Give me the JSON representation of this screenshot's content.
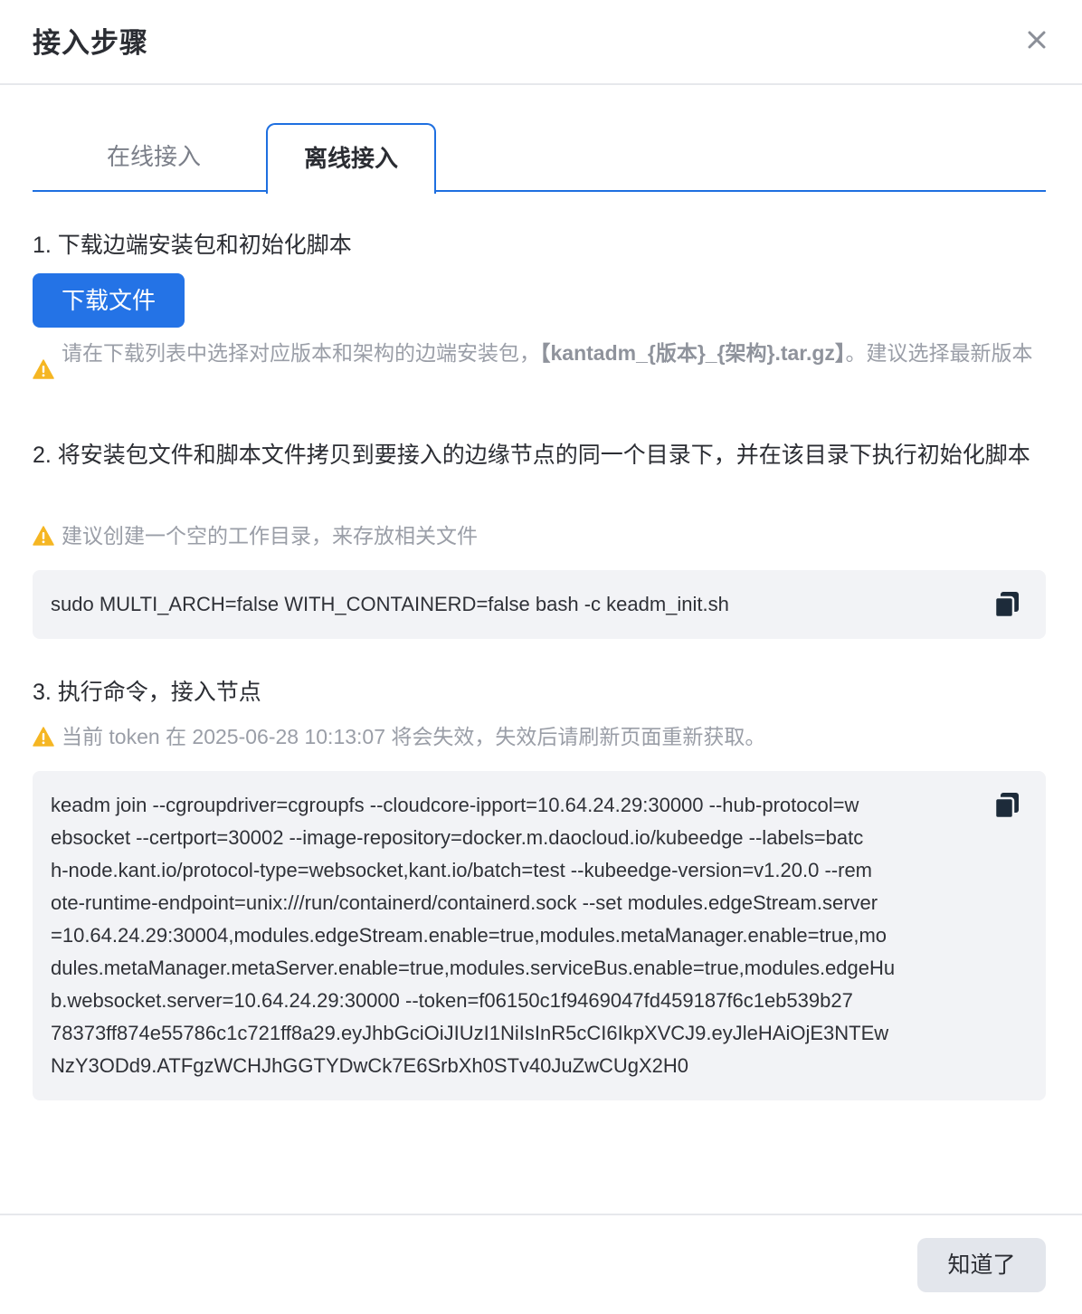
{
  "dialog": {
    "title": "接入步骤"
  },
  "tabs": [
    {
      "label": "在线接入",
      "active": false
    },
    {
      "label": "离线接入",
      "active": true
    }
  ],
  "step1": {
    "label": "1. 下载边端安装包和初始化脚本",
    "download_button": "下载文件",
    "warning_before": "请在下载列表中选择对应版本和架构的边端安装包，",
    "warning_bold": "【kantadm_{版本}_{架构}.tar.gz】",
    "warning_after": "。建议选择最新版本"
  },
  "step2": {
    "label": "2. 将安装包文件和脚本文件拷贝到要接入的边缘节点的同一个目录下，并在该目录下执行初始化脚本",
    "warning": "建议创建一个空的工作目录，来存放相关文件",
    "command": "sudo MULTI_ARCH=false WITH_CONTAINERD=false bash -c keadm_init.sh"
  },
  "step3": {
    "label": "3. 执行命令，接入节点",
    "warning": "当前 token 在 2025-06-28 10:13:07 将会失效，失效后请刷新页面重新获取。",
    "command_lines": [
      "keadm join --cgroupdriver=cgroupfs --cloudcore-ipport=10.64.24.29:30000 --hub-protocol=w",
      "ebsocket --certport=30002 --image-repository=docker.m.daocloud.io/kubeedge --labels=batc",
      "h-node.kant.io/protocol-type=websocket,kant.io/batch=test --kubeedge-version=v1.20.0 --rem",
      "ote-runtime-endpoint=unix:///run/containerd/containerd.sock  --set modules.edgeStream.server",
      "=10.64.24.29:30004,modules.edgeStream.enable=true,modules.metaManager.enable=true,mo",
      "dules.metaManager.metaServer.enable=true,modules.serviceBus.enable=true,modules.edgeHu",
      "b.websocket.server=10.64.24.29:30000 --token=f06150c1f9469047fd459187f6c1eb539b27",
      "78373ff874e55786c1c721ff8a29.eyJhbGciOiJIUzI1NiIsInR5cCI6IkpXVCJ9.eyJleHAiOjE3NTEw",
      "NzY3ODd9.ATFgzWCHJhGGTYDwCk7E6SrbXh0STv40JuZwCUgX2H0"
    ]
  },
  "footer": {
    "ok_button": "知道了"
  },
  "icons": {
    "close": "close-icon",
    "warning": "warning-icon",
    "copy": "copy-icon"
  },
  "colors": {
    "primary": "#2473e6",
    "warning": "#f5b623",
    "code_bg": "#f2f3f6"
  }
}
